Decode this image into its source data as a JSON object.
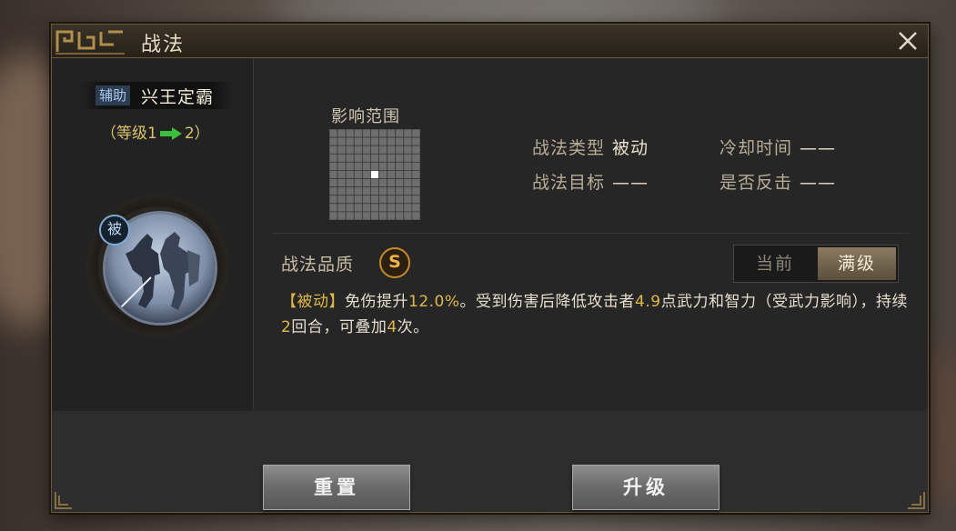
{
  "dialog": {
    "title": "战法",
    "close_icon": "close-icon"
  },
  "skill": {
    "role_badge": "辅助",
    "name": "兴王定霸",
    "level_prefix": "（等级",
    "level_from": "1",
    "level_to": "2",
    "level_suffix": "）",
    "passive_badge": "被"
  },
  "range": {
    "label": "影响范围",
    "grid_size": 11
  },
  "info": {
    "type_label": "战法类型",
    "type_value": "被动",
    "cooldown_label": "冷却时间",
    "cooldown_value": "——",
    "target_label": "战法目标",
    "target_value": "——",
    "counter_label": "是否反击",
    "counter_value": "——"
  },
  "quality": {
    "label": "战法品质",
    "grade": "S"
  },
  "toggle": {
    "current": "当前",
    "max": "满级"
  },
  "description": {
    "tag": "【被动】",
    "p1": "免伤提升",
    "n1": "12.0%",
    "p2": "。受到伤害后降低攻击者",
    "n2": "4.9",
    "p3": "点武力和智力（受武力影响），持续",
    "n3": "2",
    "p4": "回合，可叠加",
    "n4": "4",
    "p5": "次。"
  },
  "buttons": {
    "reset": "重置",
    "upgrade": "升级"
  },
  "colors": {
    "accent_gold": "#e0b84a",
    "arrow_green": "#3cbf3c"
  }
}
